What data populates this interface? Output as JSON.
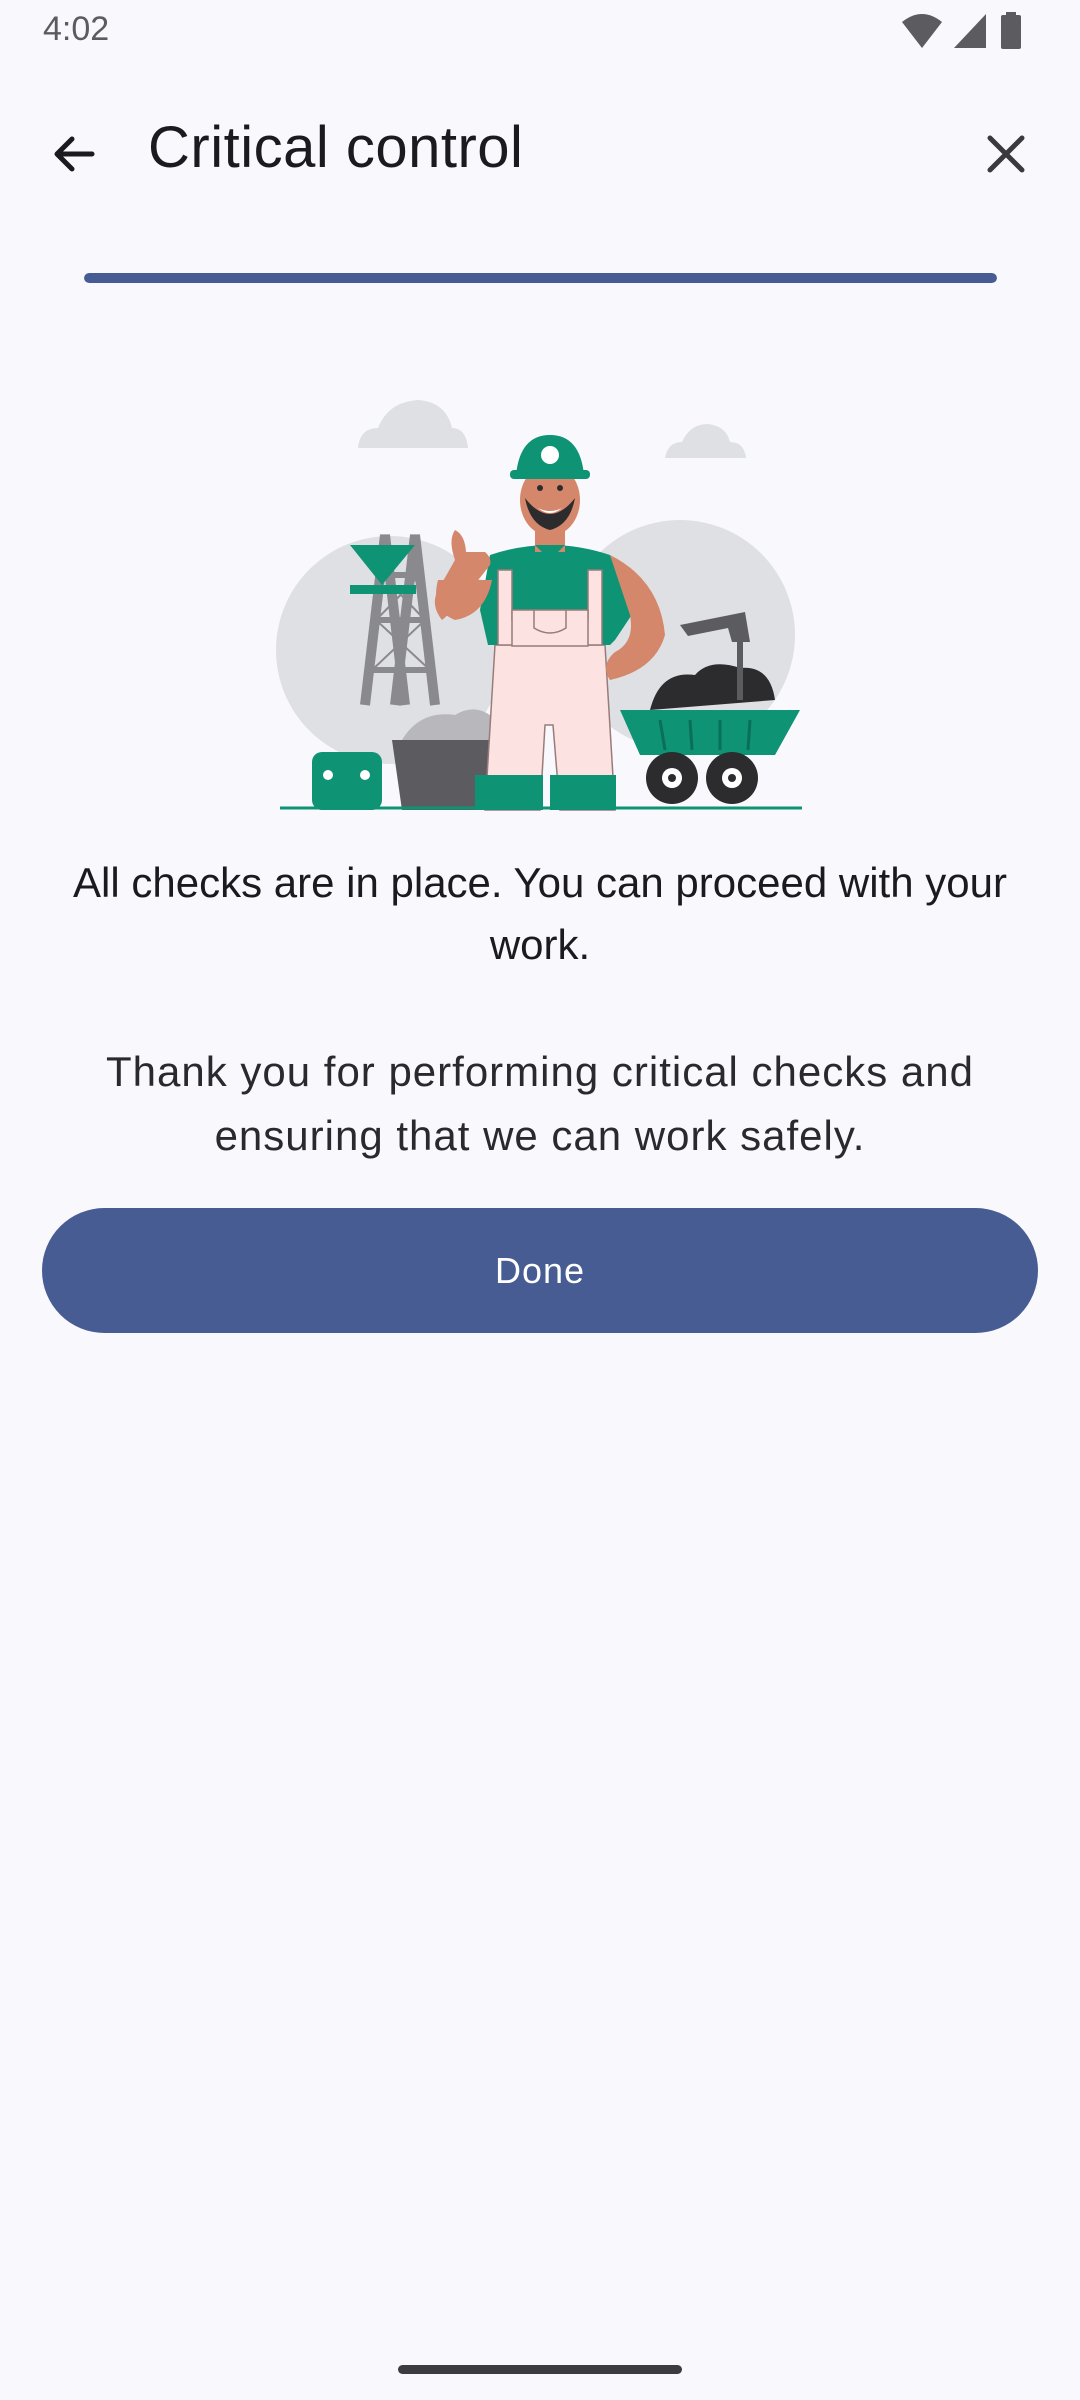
{
  "status_bar": {
    "time": "4:02",
    "icons": [
      "wifi-icon",
      "cellular-signal-icon",
      "battery-icon"
    ]
  },
  "app_bar": {
    "back_icon": "arrow-back-icon",
    "title": "Critical control",
    "close_icon": "close-icon"
  },
  "progress": {
    "fraction": 1.0,
    "color": "#465c92"
  },
  "illustration": {
    "description_icon": "miner-thumbs-up-illustration"
  },
  "message": {
    "headline": "All checks are in place. You can proceed with your work.",
    "body": "Thank you for performing critical checks and ensuring that we can work safely."
  },
  "actions": {
    "done_label": "Done"
  },
  "colors": {
    "background": "#f8f8fd",
    "primary": "#465c92",
    "accent_green": "#0e9374"
  }
}
